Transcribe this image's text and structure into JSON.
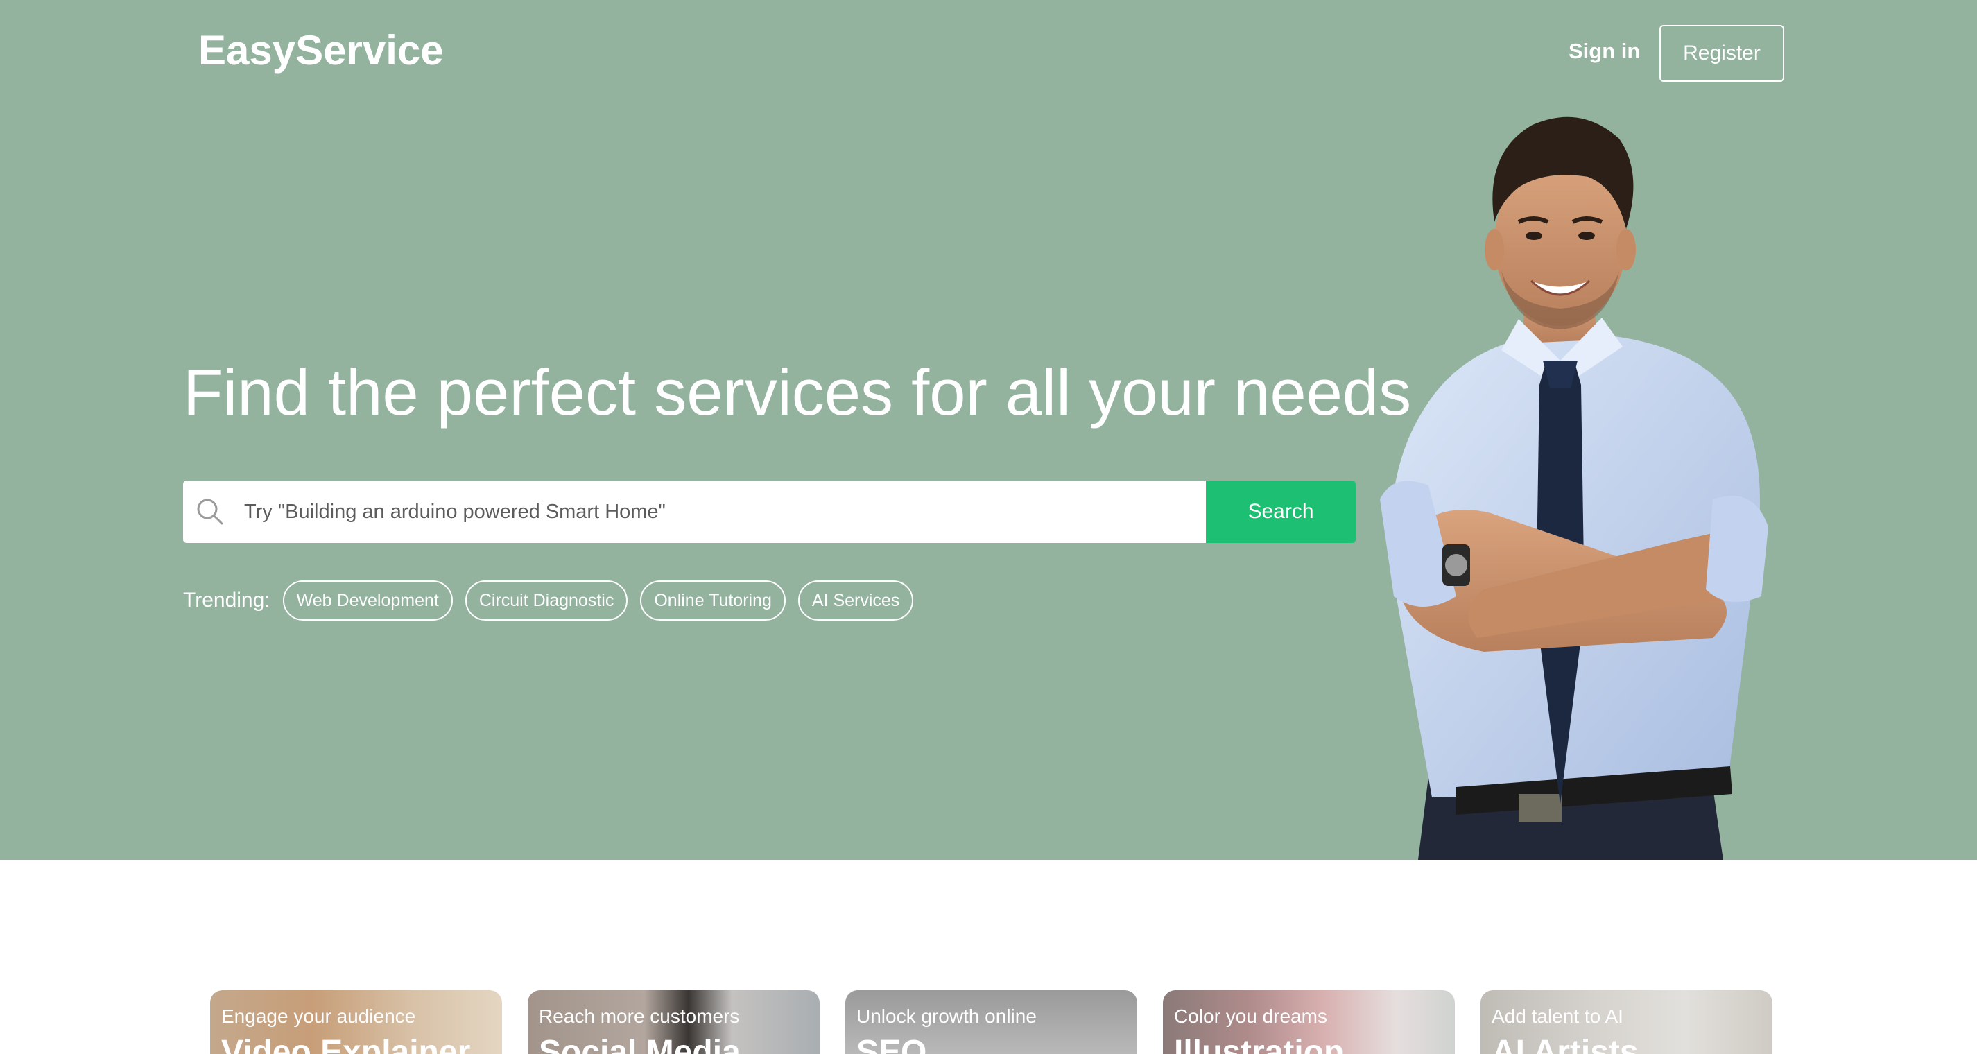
{
  "header": {
    "logo": "EasyService",
    "signin_label": "Sign in",
    "register_label": "Register"
  },
  "hero": {
    "headline": "Find the perfect services for all your needs",
    "search": {
      "placeholder": "Try \"Building an arduino powered Smart Home\"",
      "button_label": "Search",
      "icon": "search-icon"
    },
    "trending": {
      "label": "Trending:",
      "tags": [
        "Web Development",
        "Circuit Diagnostic",
        "Online Tutoring",
        "AI Services"
      ]
    },
    "background_color": "#93b39f",
    "accent_color": "#1dbf73"
  },
  "cards": [
    {
      "subtitle": "Engage your audience",
      "title": "Video Explainer"
    },
    {
      "subtitle": "Reach more customers",
      "title": "Social Media"
    },
    {
      "subtitle": "Unlock growth online",
      "title": "SEO"
    },
    {
      "subtitle": "Color you dreams",
      "title": "Illustration"
    },
    {
      "subtitle": "Add talent to AI",
      "title": "AI Artists"
    }
  ]
}
